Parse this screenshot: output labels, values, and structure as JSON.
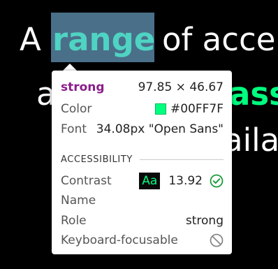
{
  "page": {
    "line1_prefix": "A",
    "highlighted_word": "range",
    "line1_suffix": "of acce",
    "line2_prefix": "a",
    "line2_green": "ass",
    "line3": "aila"
  },
  "tooltip": {
    "element_tag": "strong",
    "dimensions": "97.85 × 46.67",
    "color_label": "Color",
    "color_value": "#00FF7F",
    "font_label": "Font",
    "font_value": "34.08px \"Open Sans\"",
    "section_title": "ACCESSIBILITY",
    "contrast_label": "Contrast",
    "contrast_badge": "Aa",
    "contrast_value": "13.92",
    "name_label": "Name",
    "role_label": "Role",
    "role_value": "strong",
    "keyboard_label": "Keyboard-focusable"
  },
  "colors": {
    "highlight": "#4a6f89",
    "green": "#00FF7F",
    "tag": "#8b1d8b",
    "check": "#1a9c3c"
  },
  "icons": {
    "contrast_ok": "check-circle-icon",
    "keyboard_focusable": "not-allowed-icon"
  }
}
